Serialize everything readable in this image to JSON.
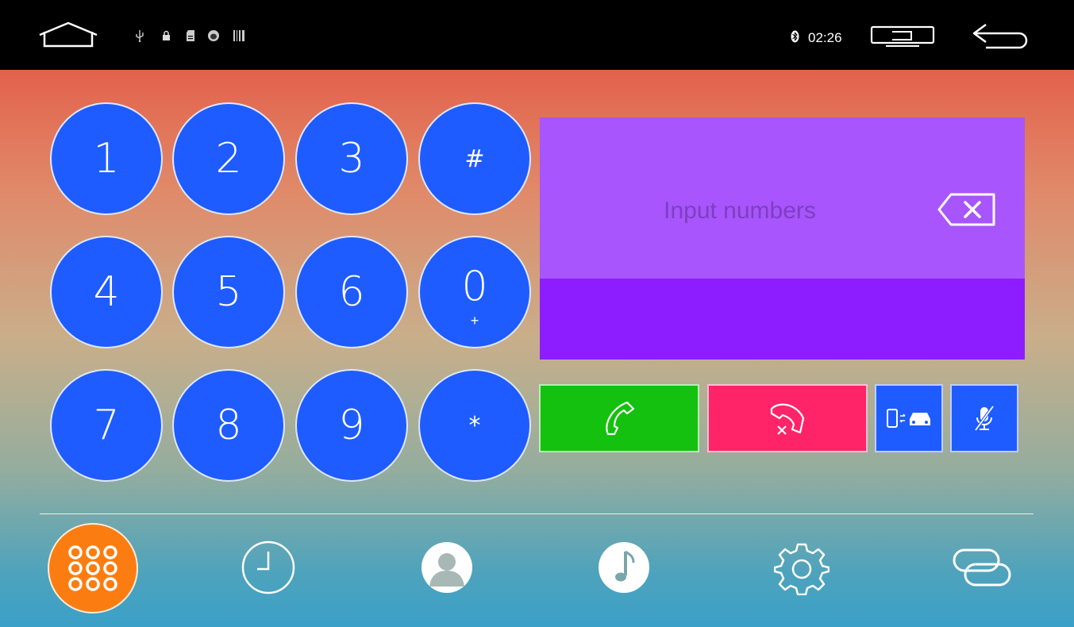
{
  "status_bar": {
    "time": "02:26",
    "icons": [
      "home-icon",
      "usb-icon",
      "lock-icon",
      "sd-card-icon",
      "android-debug-icon",
      "barcode-icon",
      "bluetooth-icon",
      "screen-mirror-icon",
      "back-icon"
    ]
  },
  "keypad": {
    "keys": [
      {
        "label": "1",
        "sub": ""
      },
      {
        "label": "2",
        "sub": ""
      },
      {
        "label": "3",
        "sub": ""
      },
      {
        "label": "#",
        "sub": ""
      },
      {
        "label": "4",
        "sub": ""
      },
      {
        "label": "5",
        "sub": ""
      },
      {
        "label": "6",
        "sub": ""
      },
      {
        "label": "0",
        "sub": "+"
      },
      {
        "label": "7",
        "sub": ""
      },
      {
        "label": "8",
        "sub": ""
      },
      {
        "label": "9",
        "sub": ""
      },
      {
        "label": "*",
        "sub": ""
      }
    ]
  },
  "display": {
    "placeholder": "Input numbers",
    "value": ""
  },
  "actions": {
    "call": {
      "icon": "phone-icon",
      "color": "#13c10e"
    },
    "hangup": {
      "icon": "hangup-icon",
      "color": "#ff2467"
    },
    "transfer": {
      "icon": "phone-to-car-icon",
      "color": "#1e5cff"
    },
    "mute": {
      "icon": "mic-mute-icon",
      "color": "#1e5cff"
    }
  },
  "nav": {
    "items": [
      {
        "name": "dialpad",
        "icon": "dialpad-icon",
        "active": true
      },
      {
        "name": "call-history",
        "icon": "clock-icon",
        "active": false
      },
      {
        "name": "contacts",
        "icon": "contact-icon",
        "active": false
      },
      {
        "name": "music",
        "icon": "music-icon",
        "active": false
      },
      {
        "name": "settings",
        "icon": "gear-icon",
        "active": false
      },
      {
        "name": "link",
        "icon": "link-icon",
        "active": false
      }
    ]
  },
  "colors": {
    "key_blue": "#1e5cff",
    "display_top": "#a855fd",
    "display_bottom": "#8d1dff",
    "nav_active": "#fb7d11"
  }
}
